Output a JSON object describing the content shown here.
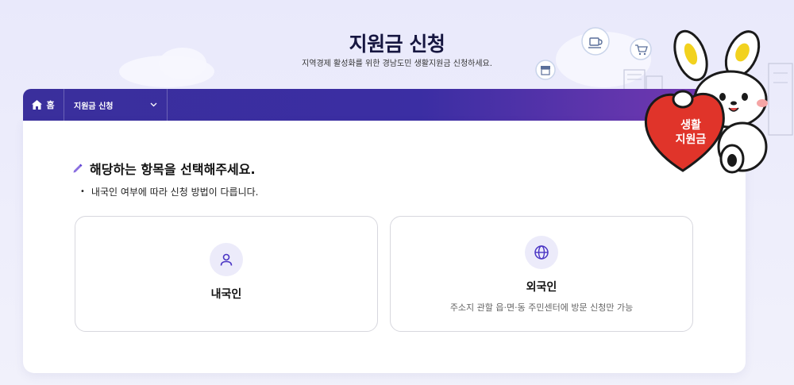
{
  "header": {
    "title": "지원금 신청",
    "subtitle": "지역경제 활성화를 위한 경남도민 생활지원금 신청하세요."
  },
  "nav": {
    "home_label": "홈",
    "dropdown_label": "지원금 신청"
  },
  "mascot": {
    "heart_text_line1": "생활",
    "heart_text_line2": "지원금"
  },
  "section": {
    "title": "해당하는 항목을 선택해주세요.",
    "description": "내국인 여부에 따라 신청 방법이 다릅니다."
  },
  "options": [
    {
      "label": "내국인",
      "description": "",
      "icon": "person-icon"
    },
    {
      "label": "외국인",
      "description": "주소지 관할 읍·면·동 주민센터에 방문 신청만 가능",
      "icon": "globe-icon"
    }
  ],
  "colors": {
    "nav_start": "#3a2f9c",
    "nav_end": "#7a3ab3",
    "accent": "#5b3fd1",
    "heart": "#e0342a"
  }
}
